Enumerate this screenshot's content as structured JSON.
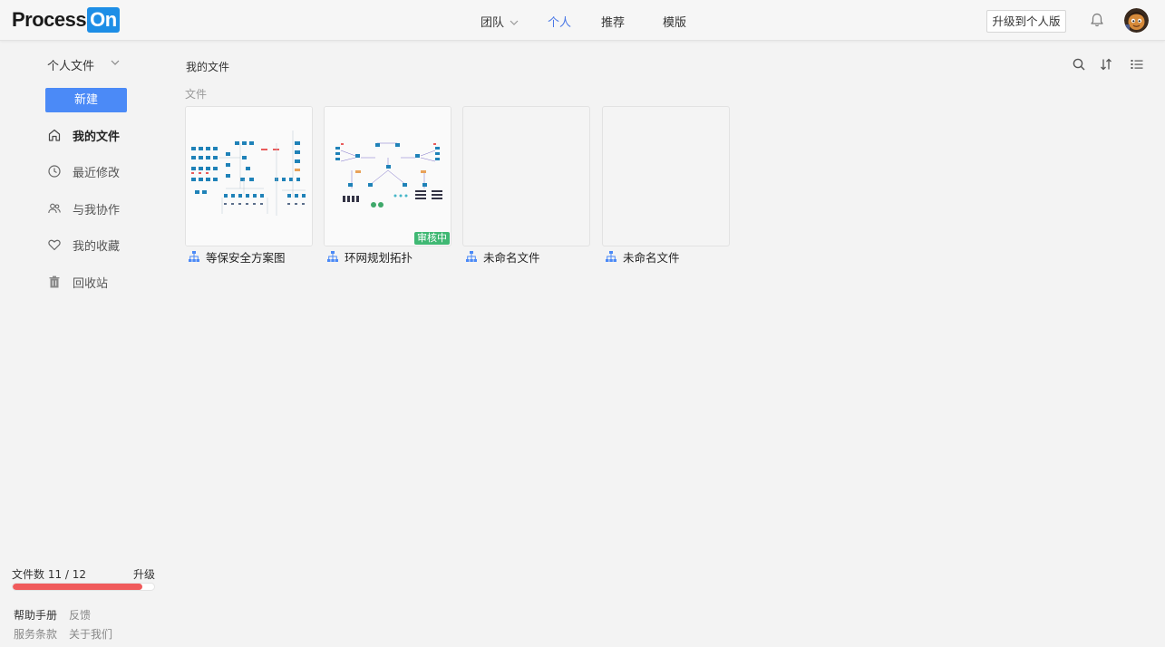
{
  "brand": {
    "logo_text": "Process",
    "logo_badge": "On"
  },
  "nav": {
    "team": "团队",
    "personal": "个人",
    "recommended": "推荐",
    "templates": "模版"
  },
  "header": {
    "upgrade_label": "升级到个人版"
  },
  "sidebar": {
    "scope": "个人文件",
    "new_label": "新建",
    "items": [
      {
        "label": "我的文件",
        "icon": "home-icon"
      },
      {
        "label": "最近修改",
        "icon": "clock-icon"
      },
      {
        "label": "与我协作",
        "icon": "users-icon"
      },
      {
        "label": "我的收藏",
        "icon": "heart-icon"
      },
      {
        "label": "回收站",
        "icon": "trash-icon"
      }
    ]
  },
  "quota": {
    "label": "文件数 11 / 12",
    "upgrade": "升级",
    "used": 11,
    "total": 12
  },
  "footer": {
    "help": "帮助手册",
    "feedback": "反馈",
    "terms": "服务条款",
    "about": "关于我们"
  },
  "main": {
    "breadcrumb": "我的文件",
    "section": "文件",
    "files": [
      {
        "title": "等保安全方案图",
        "badge": ""
      },
      {
        "title": "环网规划拓扑",
        "badge": "审核中"
      },
      {
        "title": "未命名文件",
        "badge": ""
      },
      {
        "title": "未命名文件",
        "badge": ""
      }
    ]
  },
  "colors": {
    "accent": "#4b8af7",
    "nav_active": "#4a78e6",
    "badge": "#3fb873",
    "quota": "#f05a5b"
  }
}
